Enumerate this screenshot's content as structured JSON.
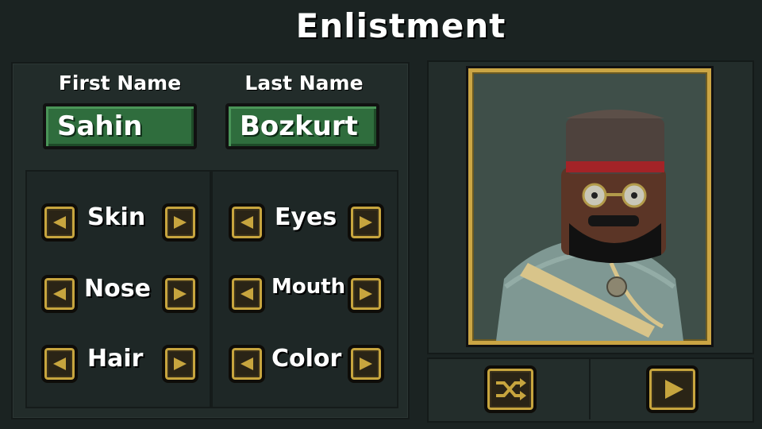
{
  "title": "Enlistment",
  "name_fields": {
    "first": {
      "label": "First Name",
      "value": "Sahin"
    },
    "last": {
      "label": "Last Name",
      "value": "Bozkurt"
    }
  },
  "appearance": {
    "left_column": [
      {
        "label": "Skin"
      },
      {
        "label": "Nose"
      },
      {
        "label": "Hair"
      }
    ],
    "right_column": [
      {
        "label": "Eyes"
      },
      {
        "label": "Mouth"
      },
      {
        "label": "Color"
      }
    ]
  },
  "icons": {
    "prev": "left-arrow-icon",
    "next": "right-arrow-icon",
    "randomize": "shuffle-icon",
    "confirm": "play-icon"
  },
  "colors": {
    "accent_gold": "#c7a53e",
    "name_field_green": "#2f6d3d",
    "panel_dark": "#222c2a"
  }
}
